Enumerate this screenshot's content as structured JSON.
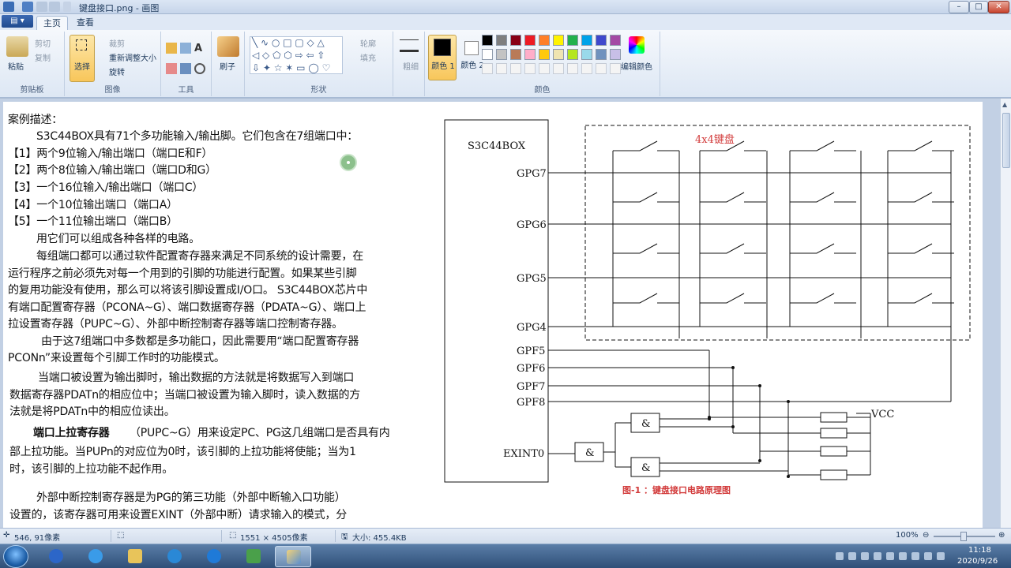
{
  "window": {
    "title": "键盘接口.png - 画图",
    "minimize": "–",
    "maximize": "□",
    "close": "✕"
  },
  "tabs": {
    "home": "主页",
    "view": "查看"
  },
  "ribbon": {
    "clipboard": {
      "paste": "粘贴",
      "cut": "剪切",
      "copy": "复制",
      "label": "剪贴板"
    },
    "image": {
      "select": "选择",
      "crop": "裁剪",
      "resize": "重新调整大小",
      "rotate": "旋转",
      "label": "图像"
    },
    "tools": {
      "label": "工具"
    },
    "brushes": {
      "label": "刷子"
    },
    "shapes": {
      "outline": "轮廓",
      "fill": "填充",
      "label": "形状"
    },
    "size": {
      "label": "粗细"
    },
    "colors": {
      "color1": "颜色 1",
      "color2": "颜色 2",
      "edit": "编辑颜色",
      "label": "颜色",
      "color1_value": "#000000",
      "color2_value": "#ffffff",
      "palette_row1": [
        "#000000",
        "#7f7f7f",
        "#880015",
        "#ed1c24",
        "#ff7f27",
        "#fff200",
        "#22b14c",
        "#00a2e8",
        "#3f48cc",
        "#a349a4"
      ],
      "palette_row2": [
        "#ffffff",
        "#c3c3c3",
        "#b97a57",
        "#ffaec9",
        "#ffc90e",
        "#efe4b0",
        "#b5e61d",
        "#99d9ea",
        "#7092be",
        "#c8bfe7"
      ]
    }
  },
  "document": {
    "lines": [
      "案例描述：",
      "S3C44BOX具有71个多功能输入/输出脚。它们包含在7组端口中：",
      "【1】两个9位输入/输出端口（端口E和F）",
      "【2】两个8位输入/输出端口（端口D和G）",
      "【3】一个16位输入/输出端口（端口C）",
      "【4】一个10位输出端口（端口A）",
      "【5】一个11位输出端口（端口B）",
      "用它们可以组成各种各样的电路。",
      "每组端口都可以通过软件配置寄存器来满足不同系统的设计需要，在",
      "运行程序之前必须先对每一个用到的引脚的功能进行配置。如果某些引脚",
      "的复用功能没有使用，那么可以将该引脚设置成I/O口。 S3C44BOX芯片中",
      "有端口配置寄存器（PCONA~G）、端口数据寄存器（PDATA~G）、端口上",
      "拉设置寄存器（PUPC~G）、外部中断控制寄存器等端口控制寄存器。",
      "由于这7组端口中多数都是多功能口，因此需要用“端口配置寄存器",
      "PCONn”来设置每个引脚工作时的功能模式。",
      "当端口被设置为输出脚时，输出数据的方法就是将数据写入到端口",
      "数据寄存器PDATn的相应位中；当端口被设置为输入脚时，读入数据的方",
      "法就是将PDATn中的相应位读出。",
      "端口上拉寄存器",
      "（PUPC~G）用来设定PC、PG这几组端口是否具有内",
      "部上拉功能。当PUPn的对应位为0时，该引脚的上拉功能将使能；当为1",
      "时，该引脚的上拉功能不起作用。",
      "外部中断控制寄存器是为PG的第三功能（外部中断输入口功能）",
      "设置的，该寄存器可用来设置EXINT（外部中断）请求输入的模式，分"
    ]
  },
  "diagram": {
    "chip": "S3C44BOX",
    "keyboard": "4x4键盘",
    "pins": [
      "GPG7",
      "GPG6",
      "GPG5",
      "GPG4",
      "GPF5",
      "GPF6",
      "GPF7",
      "GPF8",
      "EXINT0"
    ],
    "gate": "&",
    "vcc": "VCC",
    "caption": "图-1 ：键盘接口电路原理图"
  },
  "status": {
    "cursor_pos": "546, 91像素",
    "image_size": "1551 × 4505像素",
    "file_size": "大小: 455.4KB",
    "zoom": "100%"
  },
  "taskbar": {
    "time": "11:18",
    "date": "2020/9/26"
  }
}
